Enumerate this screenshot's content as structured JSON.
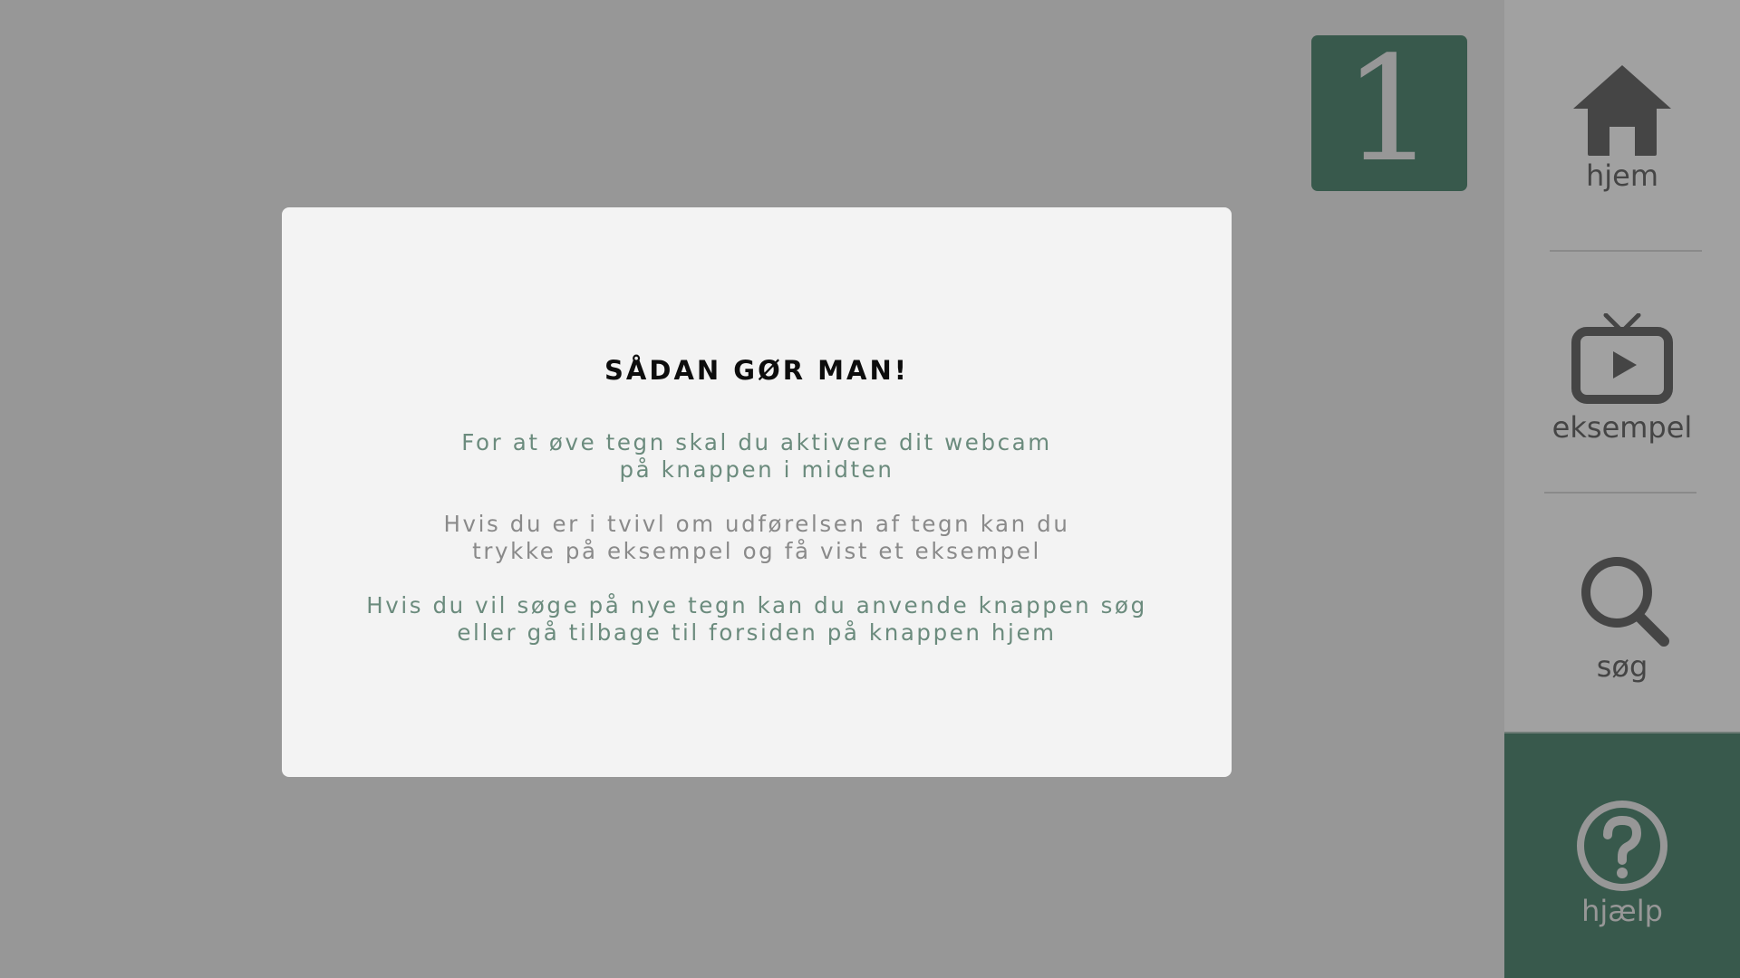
{
  "counter": {
    "value": "1"
  },
  "modal": {
    "title": "SÅDAN GØR MAN!",
    "paragraphs": [
      {
        "line1": "For at øve tegn skal du aktivere dit webcam",
        "line2": "på knappen i midten"
      },
      {
        "line1": "Hvis du er i tvivl om udførelsen af tegn kan du",
        "line2": "trykke på eksempel og få vist et eksempel"
      },
      {
        "line1": "Hvis du vil søge på nye tegn kan du anvende knappen søg",
        "line2": "eller gå tilbage til forsiden på knappen hjem"
      }
    ]
  },
  "sidebar": {
    "items": [
      {
        "label": "hjem",
        "icon": "home-icon"
      },
      {
        "label": "eksempel",
        "icon": "tv-play-icon"
      },
      {
        "label": "søg",
        "icon": "search-icon"
      },
      {
        "label": "hjælp",
        "icon": "help-circle-icon",
        "active": true
      }
    ]
  },
  "colors": {
    "background": "#979797",
    "accent": "#38594c",
    "modal": "#f3f3f3",
    "sidebar": "#a1a1a1",
    "icon": "#454545",
    "accentText": "#6b8b7d",
    "mutedText": "#8a8a8a"
  }
}
